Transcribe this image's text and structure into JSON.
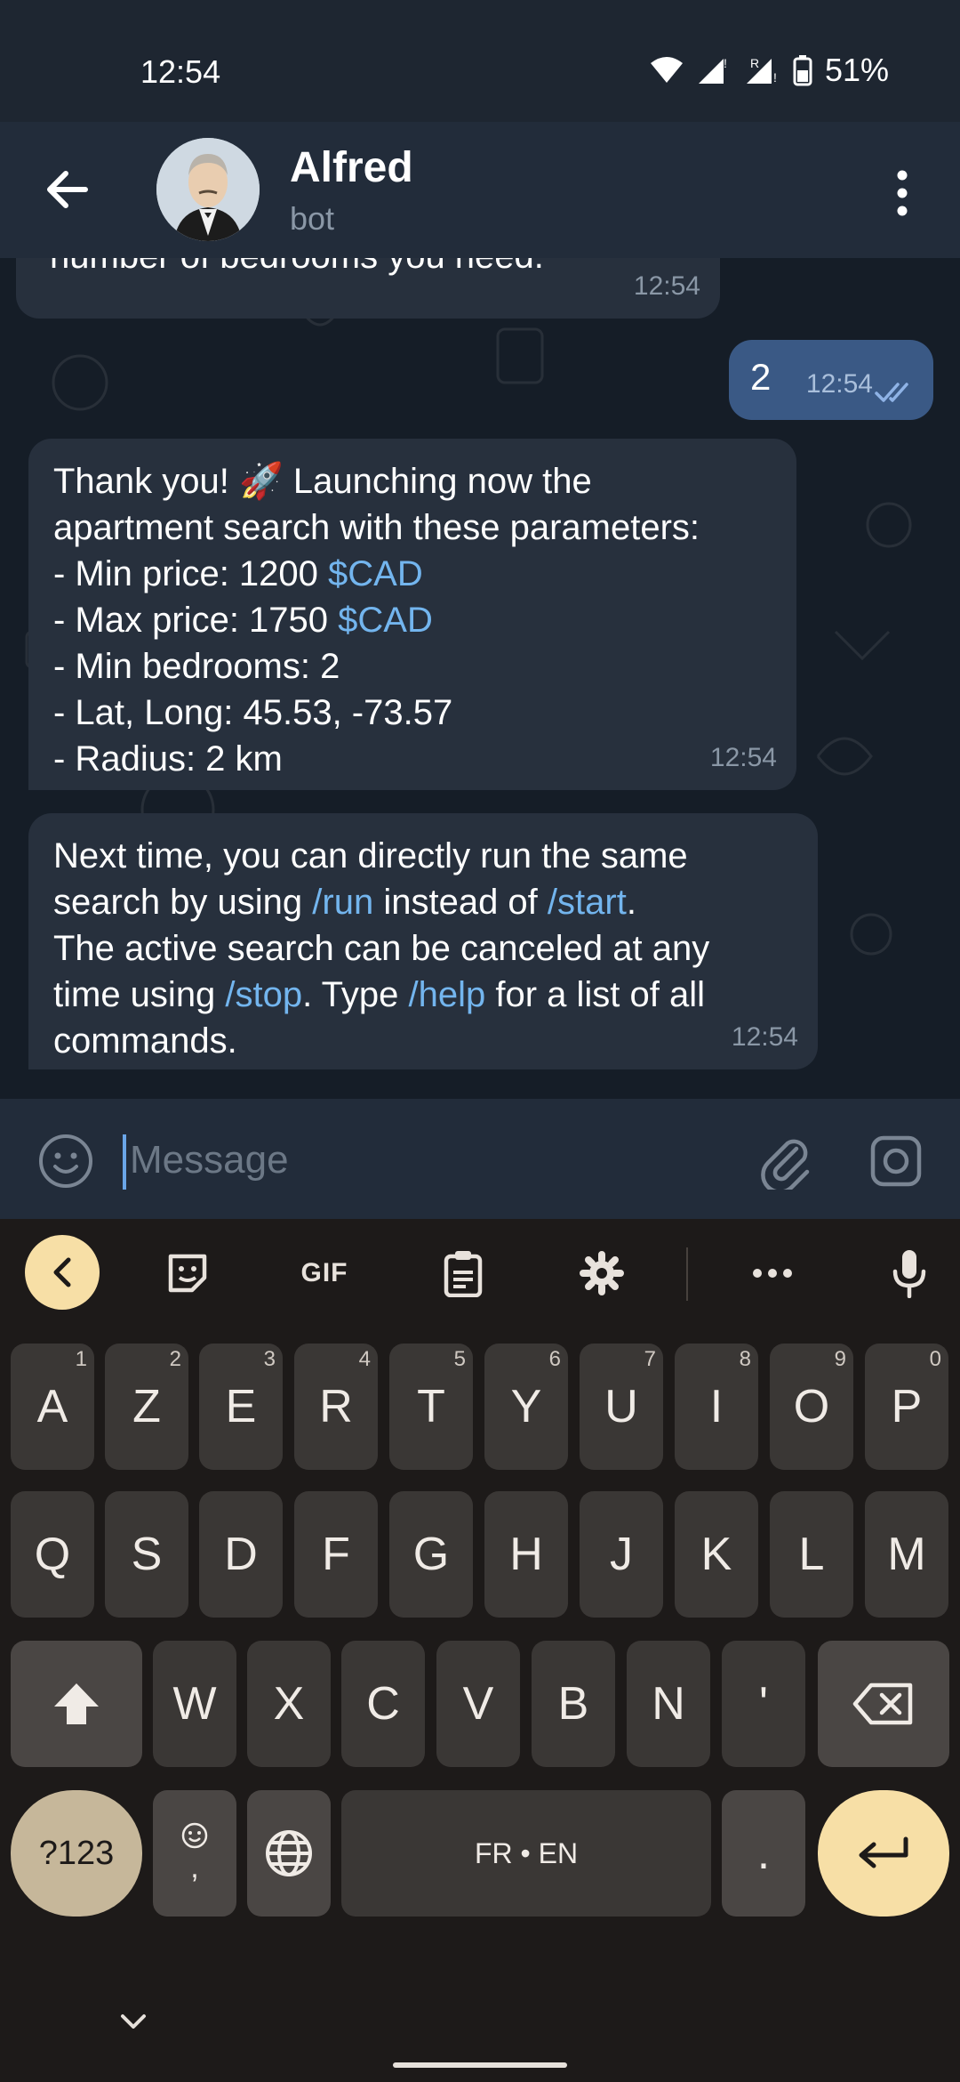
{
  "status_bar": {
    "time": "12:54",
    "battery": "51%"
  },
  "header": {
    "name": "Alfred",
    "subtitle": "bot"
  },
  "messages": {
    "m0": {
      "text": "number of bedrooms you need.",
      "time": "12:54"
    },
    "out": {
      "text": "2",
      "time": "12:54"
    },
    "m1": {
      "lines": [
        "Thank you! 🚀 Launching now the",
        "apartment search with these parameters:",
        "- Min price: 1200 ",
        "- Max price: 1750 ",
        "- Min bedrooms: 2",
        "- Lat, Long: 45.53, -73.57",
        "- Radius: 2 km"
      ],
      "currency": "$CAD",
      "time": "12:54"
    },
    "m2": {
      "l1": "Next time, you can directly run the same",
      "l2a": "search by using ",
      "cmd_run": "/run",
      "l2b": " instead of ",
      "cmd_start": "/start",
      "l2c": ".",
      "l3": "The active search can be canceled at any",
      "l4a": "time using ",
      "cmd_stop": "/stop",
      "l4b": ". Type ",
      "cmd_help": "/help",
      "l4c": " for a list of all",
      "l5": "commands.",
      "time": "12:54"
    }
  },
  "composer": {
    "placeholder": "Message"
  },
  "keyboard": {
    "gif_label": "GIF",
    "row1": [
      {
        "k": "A",
        "h": "1"
      },
      {
        "k": "Z",
        "h": "2"
      },
      {
        "k": "E",
        "h": "3"
      },
      {
        "k": "R",
        "h": "4"
      },
      {
        "k": "T",
        "h": "5"
      },
      {
        "k": "Y",
        "h": "6"
      },
      {
        "k": "U",
        "h": "7"
      },
      {
        "k": "I",
        "h": "8"
      },
      {
        "k": "O",
        "h": "9"
      },
      {
        "k": "P",
        "h": "0"
      }
    ],
    "row2": [
      "Q",
      "S",
      "D",
      "F",
      "G",
      "H",
      "J",
      "K",
      "L",
      "M"
    ],
    "row3": [
      "W",
      "X",
      "C",
      "V",
      "B",
      "N",
      "'"
    ],
    "symbols_label": "?123",
    "comma_label": ",",
    "space_label": "FR • EN",
    "period_label": "."
  },
  "colors": {
    "link": "#73b5ee",
    "outgoing_bubble": "#3a5985",
    "incoming_bubble": "#27303d",
    "accent_key": "#f7dfa6"
  }
}
